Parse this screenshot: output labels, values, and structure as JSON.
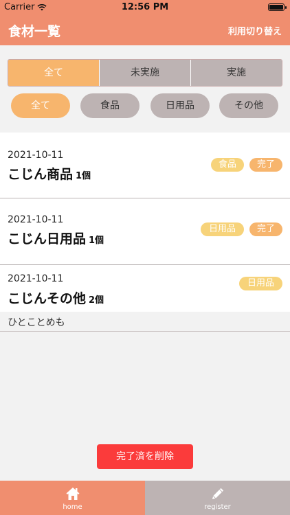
{
  "status_bar": {
    "carrier": "Carrier",
    "time": "12:56 PM"
  },
  "nav": {
    "title": "食材一覧",
    "switch_label": "利用切り替え"
  },
  "segments": [
    {
      "label": "全て",
      "active": true
    },
    {
      "label": "未実施",
      "active": false
    },
    {
      "label": "実施",
      "active": false
    }
  ],
  "categories": [
    {
      "label": "全て",
      "active": true
    },
    {
      "label": "食品",
      "active": false
    },
    {
      "label": "日用品",
      "active": false
    },
    {
      "label": "その他",
      "active": false
    }
  ],
  "items": [
    {
      "date": "2021-10-11",
      "name": "こじん商品",
      "qty": "1個",
      "category": "食品",
      "status": "完了"
    },
    {
      "date": "2021-10-11",
      "name": "こじん日用品",
      "qty": "1個",
      "category": "日用品",
      "status": "完了"
    },
    {
      "date": "2021-10-11",
      "name": "こじんその他",
      "qty": "2個",
      "category": "日用品",
      "status": ""
    }
  ],
  "memo": "ひとことめも",
  "delete_button": "完了済を削除",
  "tabs": [
    {
      "label": "home",
      "icon": "home-icon"
    },
    {
      "label": "register",
      "icon": "pencil-icon"
    }
  ],
  "colors": {
    "header": "#f08e6f",
    "accent": "#f7b56d",
    "inactive": "#bdb3b3",
    "category_tag": "#f7d37a",
    "delete": "#fb3b3b"
  }
}
